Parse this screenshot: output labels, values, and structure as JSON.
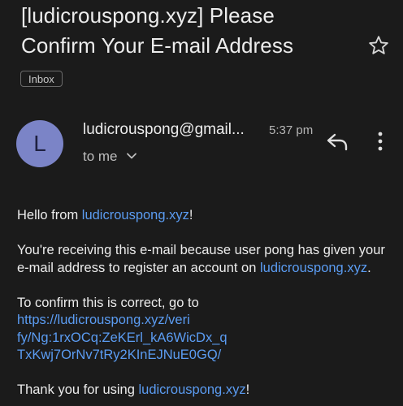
{
  "email": {
    "subject": "[ludicrouspong.xyz] Please Confirm Your E-mail Address",
    "label": "Inbox",
    "sender_initial": "L",
    "sender": "ludicrouspong@gmail...",
    "time": "5:37 pm",
    "recipient": "to me",
    "body": {
      "greeting_prefix": "Hello from ",
      "greeting_link": "ludicrouspong.xyz",
      "greeting_suffix": "!",
      "para2_text": "You're receiving this e-mail because user pong has given your e-mail address to register an account on ",
      "para2_link": "ludicrouspong.xyz",
      "para2_suffix": ".",
      "confirm_text": "To confirm this is correct, go to",
      "confirm_link_line1": "https://ludicrouspong.xyz/veri",
      "confirm_link_line2": "fy/Ng:1rxOCq:ZeKErl_kA6WicDx_q",
      "confirm_link_line3": "TxKwj7OrNv7tRy2KInEJNuE0GQ/",
      "thanks_prefix": "Thank you for using ",
      "thanks_link": "ludicrouspong.xyz",
      "thanks_suffix": "!"
    }
  },
  "icons": {
    "star": "star-outline-icon",
    "reply": "reply-icon",
    "more": "more-vert-icon",
    "chevron": "chevron-down-icon"
  },
  "colors": {
    "background": "#1b1b1b",
    "link": "#5b9cf2",
    "avatar": "#7b84c7"
  }
}
